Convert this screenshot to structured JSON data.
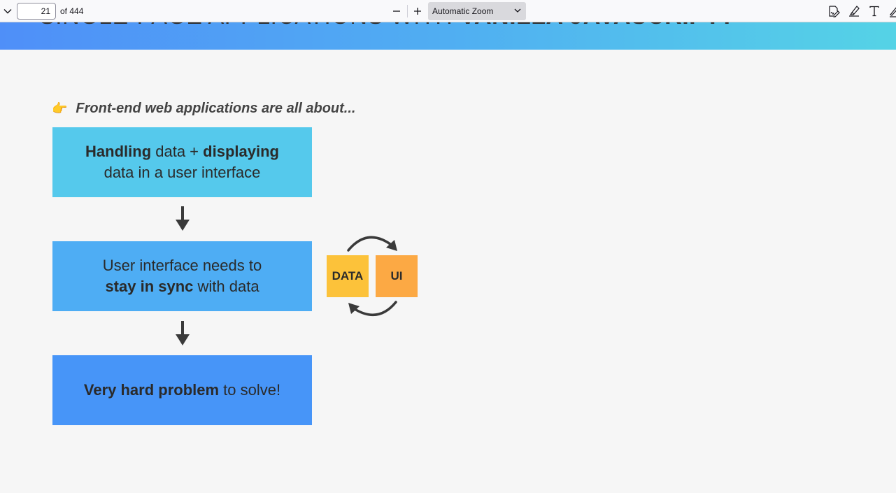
{
  "toolbar": {
    "page_number": "21",
    "page_count": "of 444",
    "zoom_value": "Automatic Zoom"
  },
  "slide": {
    "title_regular": "SINGLE-PAGE APPLICATIONS WITH ",
    "title_bold": "VANILLA JAVASCRIPT?",
    "intro_icon": "pointing-hand-icon",
    "intro_text": "Front-end web applications are all about...",
    "box1": {
      "bold1": "Handling",
      "text1": " data + ",
      "bold2": "displaying",
      "line2": "data in a user interface"
    },
    "box2": {
      "line1": "User interface needs to",
      "bold": "stay in sync",
      "text": " with data"
    },
    "box3": {
      "bold": "Very hard problem",
      "text": " to solve!"
    },
    "tag_data": "DATA",
    "tag_ui": "UI"
  },
  "colors": {
    "header_gradient": [
      "#4f8ff8",
      "#55d3e6"
    ],
    "box1": "#55c9ec",
    "box2": "#4eadf4",
    "box3": "#4795f8",
    "tag_data": "#fcc23a",
    "tag_ui": "#fca944"
  }
}
